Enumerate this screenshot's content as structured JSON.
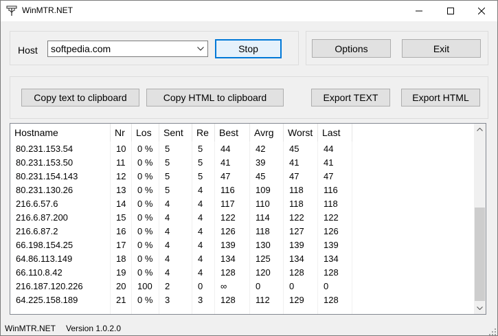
{
  "window": {
    "title": "WinMTR.NET",
    "icon": "network-icon",
    "controls": [
      "minimize-icon",
      "maximize-icon",
      "close-icon"
    ]
  },
  "host": {
    "label": "Host",
    "value": "softpedia.com"
  },
  "buttons": {
    "stop": "Stop",
    "options": "Options",
    "exit": "Exit",
    "copy_text": "Copy text to clipboard",
    "copy_html": "Copy HTML to clipboard",
    "export_text": "Export TEXT",
    "export_html": "Export HTML"
  },
  "table": {
    "columns": [
      "Hostname",
      "Nr",
      "Los",
      "Sent",
      "Re",
      "Best",
      "Avrg",
      "Worst",
      "Last"
    ],
    "rows": [
      [
        "80.231.153.54",
        "10",
        "0 %",
        "5",
        "5",
        "44",
        "42",
        "45",
        "44"
      ],
      [
        "80.231.153.50",
        "11",
        "0 %",
        "5",
        "5",
        "41",
        "39",
        "41",
        "41"
      ],
      [
        "80.231.154.143",
        "12",
        "0 %",
        "5",
        "5",
        "47",
        "45",
        "47",
        "47"
      ],
      [
        "80.231.130.26",
        "13",
        "0 %",
        "5",
        "4",
        "116",
        "109",
        "118",
        "116"
      ],
      [
        "216.6.57.6",
        "14",
        "0 %",
        "4",
        "4",
        "117",
        "110",
        "118",
        "118"
      ],
      [
        "216.6.87.200",
        "15",
        "0 %",
        "4",
        "4",
        "122",
        "114",
        "122",
        "122"
      ],
      [
        "216.6.87.2",
        "16",
        "0 %",
        "4",
        "4",
        "126",
        "118",
        "127",
        "126"
      ],
      [
        "66.198.154.25",
        "17",
        "0 %",
        "4",
        "4",
        "139",
        "130",
        "139",
        "139"
      ],
      [
        "64.86.113.149",
        "18",
        "0 %",
        "4",
        "4",
        "134",
        "125",
        "134",
        "134"
      ],
      [
        "66.110.8.42",
        "19",
        "0 %",
        "4",
        "4",
        "128",
        "120",
        "128",
        "128"
      ],
      [
        "216.187.120.226",
        "20",
        "100",
        "2",
        "0",
        "∞",
        "0",
        "0",
        "0"
      ],
      [
        "64.225.158.189",
        "21",
        "0 %",
        "3",
        "3",
        "128",
        "112",
        "129",
        "128"
      ]
    ]
  },
  "status": {
    "app": "WinMTR.NET",
    "version": "Version 1.0.2.0"
  }
}
